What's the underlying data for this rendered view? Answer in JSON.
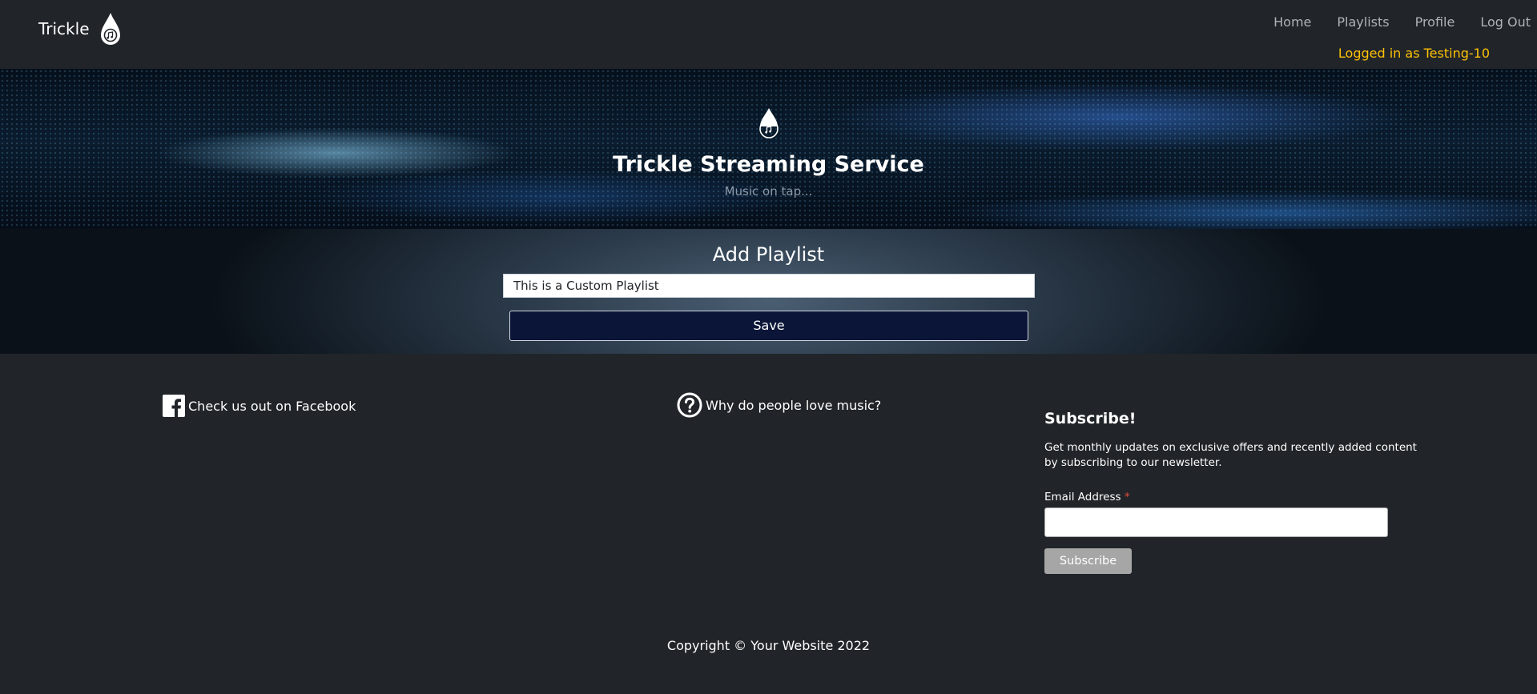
{
  "nav": {
    "brand": "Trickle",
    "links": [
      "Home",
      "Playlists",
      "Profile",
      "Log Out"
    ],
    "logged_in": "Logged in as Testing-10"
  },
  "hero": {
    "title": "Trickle Streaming Service",
    "subtitle": "Music on tap..."
  },
  "add_playlist": {
    "title": "Add Playlist",
    "input_value": "This is a Custom Playlist",
    "save_label": "Save"
  },
  "footer": {
    "facebook_text": "Check us out on Facebook",
    "question_text": "Why do people love music?",
    "subscribe_title": "Subscribe!",
    "subscribe_desc": "Get monthly updates on exclusive offers and recently added content by subscribing to our newsletter.",
    "email_label": "Email Address",
    "required_mark": "*",
    "subscribe_button": "Subscribe",
    "copyright": "Copyright © Your Website 2022"
  },
  "icons": {
    "logo": "water-drop-music-note-icon",
    "facebook": "facebook-icon",
    "question": "question-circle-icon"
  },
  "colors": {
    "background": "#212529",
    "accent_yellow": "#ffc107",
    "save_button": "#0a1538",
    "subscribe_button": "#a6a6a6"
  }
}
